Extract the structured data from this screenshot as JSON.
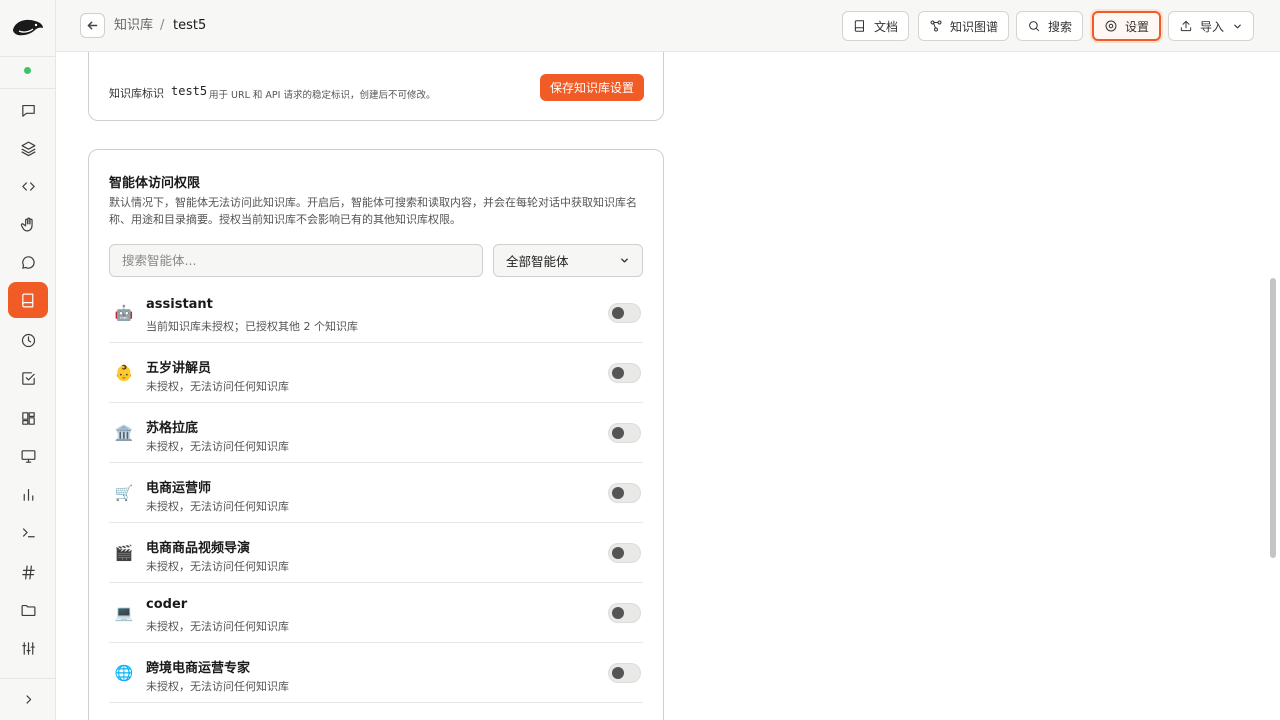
{
  "topbar": {
    "breadcrumb_parent": "知识库",
    "breadcrumb_separator": "/",
    "breadcrumb_current": "test5",
    "buttons": {
      "docs": "文档",
      "graph": "知识图谱",
      "search": "搜索",
      "settings": "设置",
      "import": "导入"
    }
  },
  "sidebar": {
    "icons": [
      "chat-icon",
      "layers-icon",
      "code-icon",
      "hand-icon",
      "message-icon",
      "book-icon",
      "clock-icon",
      "checkbox-icon",
      "grid-icon",
      "monitor-icon",
      "chart-icon",
      "terminal-icon",
      "hash-icon",
      "folder-icon",
      "sliders-icon",
      "chevron-right-icon"
    ],
    "active": "book-icon",
    "status_color": "#3cc468"
  },
  "settings_card": {
    "kb_id_label": "知识库标识",
    "kb_id_value": "test5",
    "kb_id_hint": "用于 URL 和 API 请求的稳定标识，创建后不可修改。",
    "save_button": "保存知识库设置"
  },
  "access_card": {
    "title": "智能体访问权限",
    "description": "默认情况下，智能体无法访问此知识库。开启后，智能体可搜索和读取内容，并会在每轮对话中获取知识库名称、用途和目录摘要。授权当前知识库不会影响已有的其他知识库权限。",
    "search_placeholder": "搜索智能体...",
    "filter_value": "全部智能体",
    "agents": [
      {
        "icon": "🤖",
        "name": "assistant",
        "status": "当前知识库未授权；已授权其他 2 个知识库",
        "enabled": false
      },
      {
        "icon": "👶",
        "name": "五岁讲解员",
        "status": "未授权，无法访问任何知识库",
        "enabled": false
      },
      {
        "icon": "🏛️",
        "name": "苏格拉底",
        "status": "未授权，无法访问任何知识库",
        "enabled": false
      },
      {
        "icon": "🛒",
        "name": "电商运营师",
        "status": "未授权，无法访问任何知识库",
        "enabled": false
      },
      {
        "icon": "🎬",
        "name": "电商商品视频导演",
        "status": "未授权，无法访问任何知识库",
        "enabled": false
      },
      {
        "icon": "💻",
        "name": "coder",
        "status": "未授权，无法访问任何知识库",
        "enabled": false
      },
      {
        "icon": "🌐",
        "name": "跨境电商运营专家",
        "status": "未授权，无法访问任何知识库",
        "enabled": false
      }
    ]
  },
  "colors": {
    "accent": "#f05b26",
    "sidebar_bg": "#f7f7f6"
  }
}
